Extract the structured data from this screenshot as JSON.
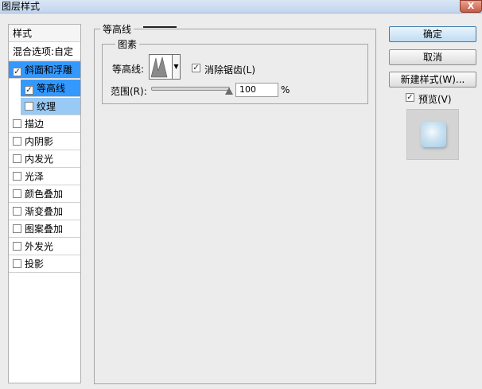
{
  "window": {
    "title": "图层样式",
    "close_label": "X"
  },
  "style_list": {
    "header": "样式",
    "blend_options": "混合选项:自定",
    "items": [
      {
        "label": "斜面和浮雕",
        "checked": true,
        "state": "selected"
      },
      {
        "label": "等高线",
        "checked": true,
        "state": "sub-selected"
      },
      {
        "label": "纹理",
        "checked": false,
        "state": "sub"
      },
      {
        "label": "描边",
        "checked": false
      },
      {
        "label": "内阴影",
        "checked": false
      },
      {
        "label": "内发光",
        "checked": false
      },
      {
        "label": "光泽",
        "checked": false
      },
      {
        "label": "颜色叠加",
        "checked": false
      },
      {
        "label": "渐变叠加",
        "checked": false
      },
      {
        "label": "图案叠加",
        "checked": false
      },
      {
        "label": "外发光",
        "checked": false
      },
      {
        "label": "投影",
        "checked": false
      }
    ]
  },
  "panel": {
    "title": "等高线",
    "group_title": "图素",
    "contour_label": "等高线:",
    "antialias_label": "消除锯齿(L)",
    "antialias_checked": true,
    "range_label": "范围(R):",
    "range_value": "100",
    "range_unit": "%",
    "range_fraction": 1.0
  },
  "buttons": {
    "ok": "确定",
    "cancel": "取消",
    "new_style": "新建样式(W)...",
    "preview_label": "预览(V)",
    "preview_checked": true
  },
  "colors": {
    "selection": "#3399ff",
    "sub_item": "#99c9f5",
    "dialog_bg": "#ececec"
  }
}
